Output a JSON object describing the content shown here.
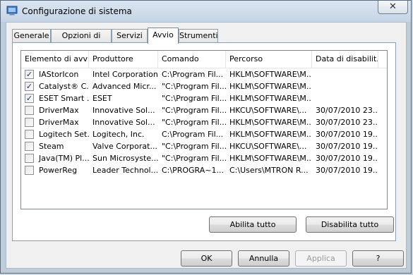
{
  "window": {
    "title": "Configurazione di sistema",
    "close_label": "✕"
  },
  "tabs": [
    {
      "label": "Generale"
    },
    {
      "label": "Opzioni di avvio"
    },
    {
      "label": "Servizi"
    },
    {
      "label": "Avvio"
    },
    {
      "label": "Strumenti"
    }
  ],
  "active_tab": "Avvio",
  "columns": [
    "Elemento di avvio",
    "Produttore",
    "Comando",
    "Percorso",
    "Data di disabilit..."
  ],
  "rows": [
    {
      "checked": true,
      "item": "IAStorIcon",
      "maker": "Intel Corporation",
      "command": "C:\\Program Fil...",
      "path": "HKLM\\SOFTWARE\\M...",
      "date": ""
    },
    {
      "checked": true,
      "item": "Catalyst® C...",
      "maker": "Advanced Micr...",
      "command": "\"C:\\Program Fil...",
      "path": "HKLM\\SOFTWARE\\M...",
      "date": ""
    },
    {
      "checked": true,
      "item": "ESET Smart ...",
      "maker": "ESET",
      "command": "\"C:\\Program Fil...",
      "path": "HKLM\\SOFTWARE\\M...",
      "date": ""
    },
    {
      "checked": false,
      "item": "DriverMax",
      "maker": "Innovative Sol...",
      "command": "\"C:\\Program Fil...",
      "path": "HKCU\\SOFTWARE\\...",
      "date": "30/07/2010 23..."
    },
    {
      "checked": false,
      "item": "DriverMax",
      "maker": "Innovative Sol...",
      "command": "\"C:\\Program Fil...",
      "path": "HKLM\\SOFTWARE\\M...",
      "date": "30/07/2010 23..."
    },
    {
      "checked": false,
      "item": "Logitech Set...",
      "maker": "Logitech, Inc.",
      "command": "C:\\Program Fil...",
      "path": "HKLM\\SOFTWARE\\M...",
      "date": "30/07/2010 19..."
    },
    {
      "checked": false,
      "item": "Steam",
      "maker": "Valve Corporat...",
      "command": "\"C:\\Program Fil...",
      "path": "HKCU\\SOFTWARE\\...",
      "date": "30/07/2010 19..."
    },
    {
      "checked": false,
      "item": "Java(TM) Pl...",
      "maker": "Sun Microsyste...",
      "command": "\"C:\\Program Fil...",
      "path": "HKLM\\SOFTWARE\\M...",
      "date": "30/07/2010 19..."
    },
    {
      "checked": false,
      "item": "PowerReg",
      "maker": "Leader Technol...",
      "command": "C:\\PROGRA~1...",
      "path": "C:\\Users\\MTRON R...",
      "date": "30/07/2010 19..."
    }
  ],
  "panel_buttons": {
    "enable_all": "Abilita tutto",
    "disable_all": "Disabilita tutto"
  },
  "dialog_buttons": {
    "ok": "OK",
    "cancel": "Annulla",
    "apply": "Applica",
    "help": "?"
  },
  "colors": {
    "check": "#1c2e5a",
    "disabled_text": "#9a9a9a"
  }
}
